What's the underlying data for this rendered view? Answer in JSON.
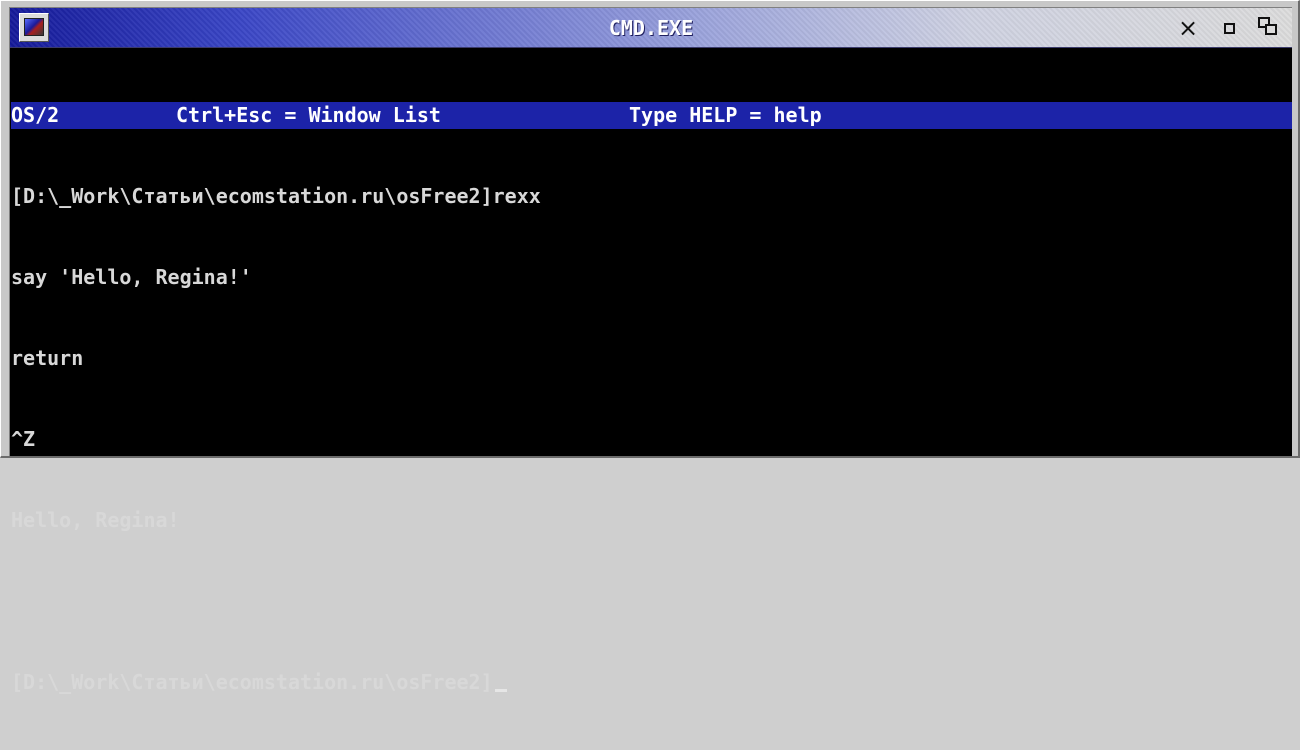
{
  "window": {
    "title": "CMD.EXE",
    "controls": {
      "close": "×"
    }
  },
  "status": {
    "os": "OS/2",
    "window_list": "Ctrl+Esc = Window List",
    "help": "Type HELP = help"
  },
  "console": {
    "lines": [
      "[D:\\_Work\\Статьи\\ecomstation.ru\\osFree2]rexx",
      "say 'Hello, Regina!'",
      "return",
      "^Z",
      "Hello, Regina!",
      "",
      "[D:\\_Work\\Статьи\\ecomstation.ru\\osFree2]"
    ]
  },
  "colors": {
    "console_background": "#000000",
    "console_text": "#d8d8d8",
    "status_bar": "#1c23a8",
    "title_gradient_start": "#151a9a"
  }
}
